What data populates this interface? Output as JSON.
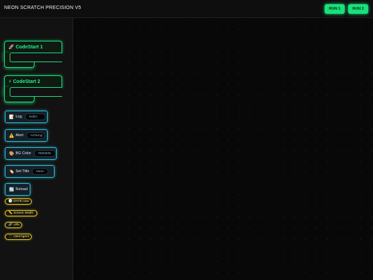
{
  "header": {
    "title": "NEON SCRATCH PRECISION V5",
    "run1_label": "RUN 1",
    "run2_label": "RUN 2"
  },
  "sidebar": {
    "events": [
      {
        "icon": "🚀",
        "label": "CodeStart 1"
      },
      {
        "icon": "⚡",
        "label": "CodeStart 2"
      }
    ],
    "actions": {
      "log": {
        "icon": "📝",
        "label": "Log",
        "value": "Hallo!"
      },
      "alert": {
        "icon": "⚠️",
        "label": "Alert",
        "value": "Achtung"
      },
      "bgcolor": {
        "icon": "🎨",
        "label": "BG Color",
        "value": "#050505"
      },
      "settitle": {
        "icon": "🏷️",
        "label": "Set Title",
        "value": "Neon"
      },
      "reload": {
        "icon": "🔄",
        "label": "Reload"
      }
    },
    "values": [
      {
        "icon": "🕒",
        "label": "DATE.now"
      },
      {
        "icon": "📏",
        "label": "Screen Width"
      },
      {
        "icon": "🔗",
        "label": "URL"
      },
      {
        "icon": "📱",
        "label": "UserAgent"
      }
    ]
  },
  "colors": {
    "event_accent": "#19e07a",
    "action_accent": "#2dbfd6",
    "value_accent": "#e6c72a",
    "background": "#0b0b0b"
  }
}
